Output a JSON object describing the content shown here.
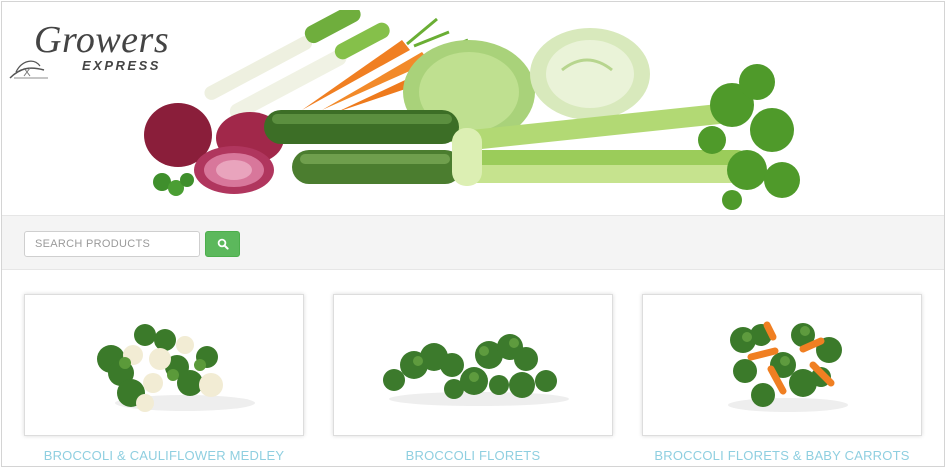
{
  "brand": {
    "name_line1": "Growers",
    "name_line2": "EXPRESS"
  },
  "search": {
    "placeholder": "SEARCH PRODUCTS",
    "value": "",
    "button_icon": "search-icon",
    "button_color": "#5cb85c"
  },
  "products": [
    {
      "title": "BROCCOLI & CAULIFLOWER MEDLEY",
      "image": "broccoli-cauliflower-medley"
    },
    {
      "title": "BROCCOLI FLORETS",
      "image": "broccoli-florets"
    },
    {
      "title": "BROCCOLI FLORETS & BABY CARROTS",
      "image": "broccoli-florets-baby-carrots"
    }
  ],
  "colors": {
    "accent_green": "#5cb85c",
    "product_link": "#8fcfe0",
    "search_band": "#f4f4f4"
  }
}
